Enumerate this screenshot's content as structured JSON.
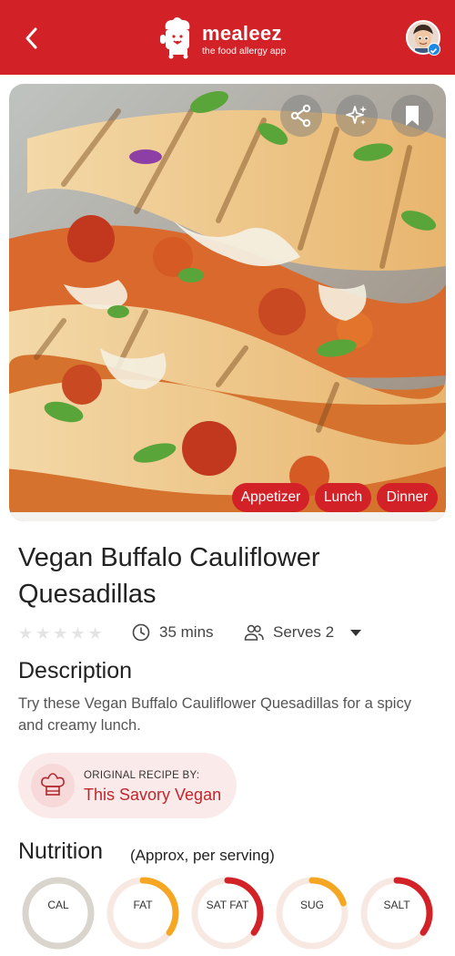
{
  "app": {
    "brand": "mealeez",
    "tagline": "the food allergy app"
  },
  "actions": [
    "share-icon",
    "sparkle-icon",
    "bookmark-icon"
  ],
  "tags": [
    "Appetizer",
    "Lunch",
    "Dinner"
  ],
  "recipe": {
    "title": "Vegan Buffalo Cauliflower Quesadillas",
    "rating": 0,
    "rating_max": 5,
    "time": "35 mins",
    "serves": "Serves 2"
  },
  "description": {
    "heading": "Description",
    "text": "Try these Vegan Buffalo Cauliflower Quesadillas for a spicy and creamy lunch."
  },
  "credit": {
    "label": "ORIGINAL RECIPE BY:",
    "name": "This Savory Vegan"
  },
  "nutrition": {
    "heading": "Nutrition",
    "note": "(Approx, per serving)",
    "items": [
      {
        "label": "CAL",
        "level": 0,
        "color": "#d9d4cc"
      },
      {
        "label": "FAT",
        "level": 0.35,
        "color": "#f5a623"
      },
      {
        "label": "SAT FAT",
        "level": 0.35,
        "color": "#d32128"
      },
      {
        "label": "SUG",
        "level": 0.2,
        "color": "#f5a623"
      },
      {
        "label": "SALT",
        "level": 0.35,
        "color": "#d32128"
      }
    ]
  },
  "colors": {
    "brand_red": "#d32128",
    "amber": "#f5a623"
  }
}
